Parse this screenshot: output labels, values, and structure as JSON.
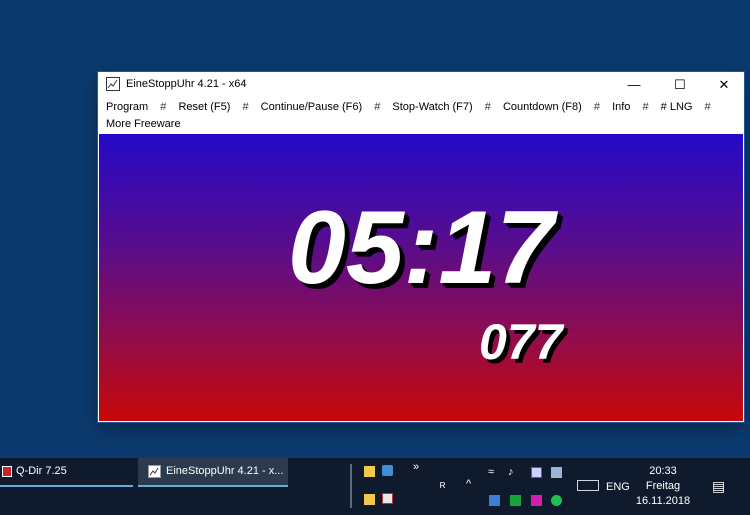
{
  "window": {
    "title": "EineStoppUhr 4.21 - x64",
    "controls": {
      "minimize": "—",
      "maximize": "☐",
      "close": "✕"
    }
  },
  "menu": {
    "items": [
      "Program",
      "Reset (F5)",
      "Continue/Pause (F6)",
      "Stop-Watch (F7)",
      "Countdown (F8)",
      "Info",
      "# LNG"
    ],
    "separator": "#",
    "more": "More Freeware"
  },
  "timer": {
    "main": "05:17",
    "sub": "077"
  },
  "taskbar": {
    "tasks": [
      {
        "label": "Q-Dir 7.25",
        "icon": "q-dir-icon"
      },
      {
        "label": "EineStoppUhr 4.21 - x...",
        "icon": "stopwatch-app-icon"
      }
    ],
    "overflow": "»",
    "tray_chevron": "^",
    "language": "ENG",
    "clock": {
      "time": "20:33",
      "day": "Freitag",
      "date": "16.11.2018"
    }
  }
}
